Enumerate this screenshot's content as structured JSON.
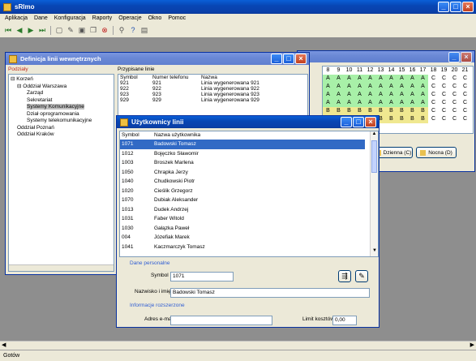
{
  "app": {
    "title": "sRlmo"
  },
  "menu": [
    "Aplikacja",
    "Dane",
    "Konfiguracja",
    "Raporty",
    "Operacje",
    "Okno",
    "Pomoc"
  ],
  "def_window": {
    "title": "Definicja linii wewnętrznych",
    "structure_label": "Podziały",
    "tree": [
      "Korzeń",
      "Oddział Warszawa",
      "Zarząd",
      "Sekretariat",
      "Systemy Komunikacyjne",
      "Dział oprogramowania",
      "Systemy telekomunikacyjne",
      "Oddział Poznań",
      "Oddział Kraków"
    ],
    "lines_label": "Przypisane linie",
    "lines_headers": [
      "Symbol",
      "Numer telefonu",
      "Nazwa"
    ],
    "lines_rows": [
      [
        "921",
        "921",
        "Linia wygenerowana 921"
      ],
      [
        "922",
        "922",
        "Linia wygenerowana 922"
      ],
      [
        "923",
        "923",
        "Linia wygenerowana 923"
      ],
      [
        "929",
        "929",
        "Linia wygenerowana 929"
      ]
    ]
  },
  "schedule": {
    "hours": [
      "8",
      "9",
      "10",
      "11",
      "12",
      "13",
      "14",
      "15",
      "16",
      "17",
      "18",
      "19",
      "20",
      "21",
      "22",
      "23"
    ],
    "rows": [
      [
        "A",
        "A",
        "A",
        "A",
        "A",
        "A",
        "A",
        "A",
        "A",
        "A",
        "C",
        "C",
        "C",
        "C",
        "C",
        "C"
      ],
      [
        "A",
        "A",
        "A",
        "A",
        "A",
        "A",
        "A",
        "A",
        "A",
        "A",
        "C",
        "C",
        "C",
        "C",
        "C",
        "C"
      ],
      [
        "A",
        "A",
        "A",
        "A",
        "A",
        "A",
        "A",
        "A",
        "A",
        "A",
        "C",
        "C",
        "C",
        "C",
        "C",
        "C"
      ],
      [
        "A",
        "A",
        "A",
        "A",
        "A",
        "A",
        "A",
        "A",
        "A",
        "A",
        "C",
        "C",
        "C",
        "C",
        "C",
        "C"
      ],
      [
        "",
        "",
        "",
        "",
        "",
        "",
        "",
        "",
        "",
        "",
        "",
        "",
        "",
        "",
        "",
        ""
      ],
      [
        "B",
        "B",
        "B",
        "B",
        "B",
        "B",
        "B",
        "B",
        "B",
        "B",
        "C",
        "C",
        "C",
        "C",
        "C",
        "C"
      ],
      [
        "B",
        "B",
        "B",
        "B",
        "B",
        "B",
        "B",
        "B",
        "B",
        "B",
        "C",
        "C",
        "C",
        "C",
        "C",
        "C"
      ]
    ],
    "day_button": "Dzienna (C)",
    "night_button": "Nocna (D)"
  },
  "users_dialog": {
    "title": "Użytkownicy linii",
    "headers": [
      "Symbol",
      "Nazwa użytkownika"
    ],
    "rows": [
      [
        "1071",
        "Badowski Tomasz"
      ],
      [
        "1012",
        "Bojęczko Sławomir"
      ],
      [
        "1003",
        "Broszek Marlena"
      ],
      [
        "1050",
        "Chrapka Jerzy"
      ],
      [
        "1040",
        "Chudkowski Piotr"
      ],
      [
        "1020",
        "Cieślik Grzegorz"
      ],
      [
        "1070",
        "Dubiak Aleksander"
      ],
      [
        "1013",
        "Dudek Andrzej"
      ],
      [
        "1031",
        "Faber Witold"
      ],
      [
        "1030",
        "Gałązka Paweł"
      ],
      [
        "004",
        "Józefiak Marek"
      ],
      [
        "1041",
        "Kaczmarczyk Tomasz"
      ]
    ],
    "personal_label": "Dane personalne",
    "symbol_label": "Symbol",
    "symbol_value": "1071",
    "name_label": "Nazwisko i imię",
    "name_value": "Badowski Tomasz",
    "extra_label": "Informacje rozszerzone",
    "email_label": "Adres e-mail",
    "email_value": "",
    "limit_label": "Limit kosztów",
    "limit_value": "0,00"
  },
  "status": {
    "text": "Gotów"
  }
}
